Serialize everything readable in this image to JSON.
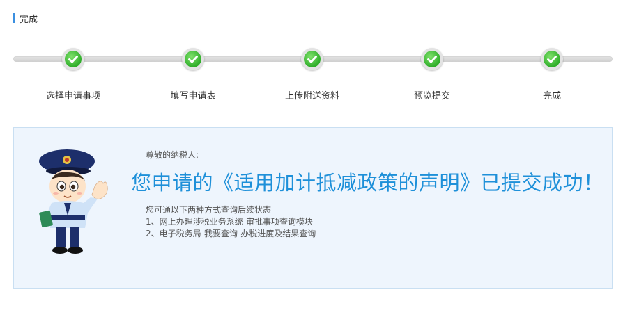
{
  "section": {
    "title": "完成"
  },
  "steps": [
    {
      "label": "选择申请事项",
      "status": "done"
    },
    {
      "label": "填写申请表",
      "status": "done"
    },
    {
      "label": "上传附送资料",
      "status": "done"
    },
    {
      "label": "预览提交",
      "status": "done"
    },
    {
      "label": "完成",
      "status": "done"
    }
  ],
  "result": {
    "greeting": "尊敬的纳税人:",
    "headline": "您申请的《适用加计抵减政策的声明》已提交成功！",
    "tips_intro": "您可通以下两种方式查询后续状态",
    "tips": [
      "1、网上办理涉税业务系统-审批事项查询模块",
      "2、电子税务局-我要查询-办税进度及结果查询"
    ]
  },
  "colors": {
    "accent": "#1e90d9",
    "success": "#2fae2a",
    "panel_bg": "#eef5fd"
  },
  "icons": {
    "step_icon": "check-circle-icon",
    "mascot": "police-mascot-illustration"
  }
}
